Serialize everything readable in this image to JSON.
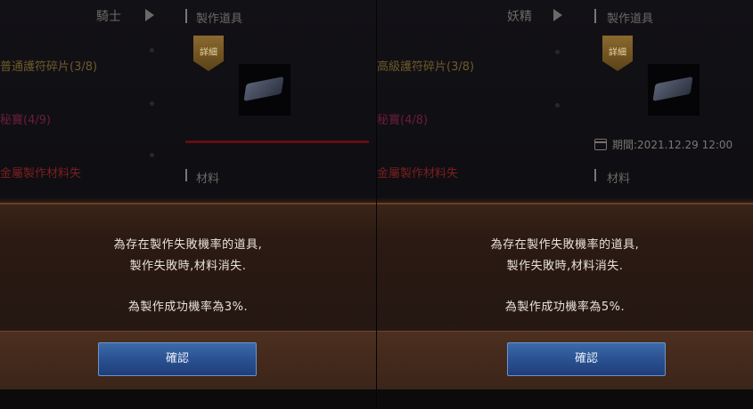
{
  "left": {
    "class_name": "騎士",
    "section_title": "製作道具",
    "badge_label": "詳細",
    "list_items": [
      {
        "text": "普通護符碎片(3/8)",
        "color": "#6e5a2a"
      },
      {
        "text": "秘寶(4/9)",
        "color": "#6b1c3c"
      },
      {
        "text": "金屬製作材料失",
        "color": "#7a1f1f"
      }
    ],
    "red_text": "",
    "materials_label": "材料",
    "dialog": {
      "line1": "為存在製作失敗機率的道具,",
      "line2": "製作失敗時,材料消失.",
      "line3": "為製作成功機率為3%.",
      "confirm_label": "確認"
    }
  },
  "right": {
    "class_name": "妖精",
    "section_title": "製作道具",
    "badge_label": "詳細",
    "list_items": [
      {
        "text": "高級護符碎片(3/8)",
        "color": "#6e5a2a"
      },
      {
        "text": "秘寶(4/8)",
        "color": "#6b1c3c"
      },
      {
        "text": "金屬製作材料失",
        "color": "#7a1f1f"
      }
    ],
    "expiry_text": "期間:2021.12.29 12:00",
    "materials_label": "材料",
    "dialog": {
      "line1": "為存在製作失敗機率的道具,",
      "line2": "製作失敗時,材料消失.",
      "line3": "為製作成功機率為5%.",
      "confirm_label": "確認"
    }
  }
}
